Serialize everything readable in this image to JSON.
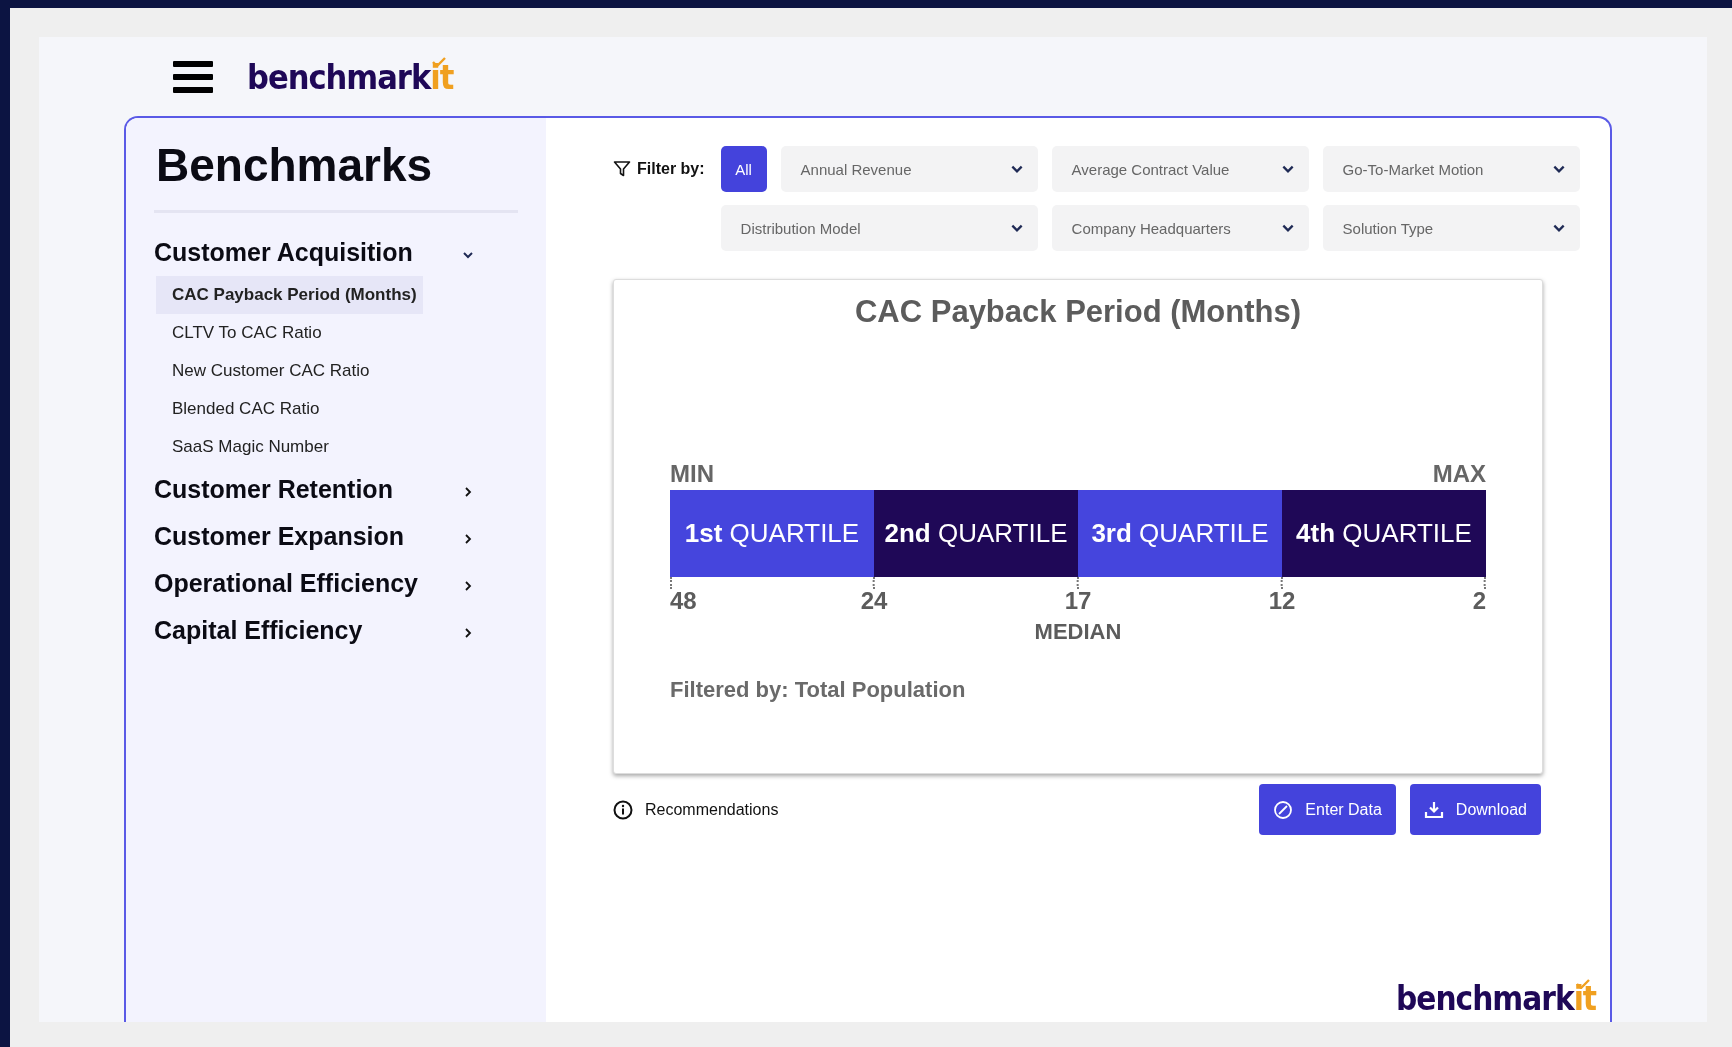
{
  "header": {
    "logo": {
      "text": "benchmark",
      "accent": "it"
    }
  },
  "sidebar": {
    "title": "Benchmarks",
    "sections": [
      {
        "label": "Customer Acquisition",
        "expanded": true,
        "children": [
          {
            "label": "CAC Payback Period (Months)",
            "selected": true
          },
          {
            "label": "CLTV To CAC Ratio",
            "selected": false
          },
          {
            "label": "New Customer CAC Ratio",
            "selected": false
          },
          {
            "label": "Blended CAC Ratio",
            "selected": false
          },
          {
            "label": "SaaS Magic Number",
            "selected": false
          }
        ]
      },
      {
        "label": "Customer Retention",
        "expanded": false
      },
      {
        "label": "Customer Expansion",
        "expanded": false
      },
      {
        "label": "Operational Efficiency",
        "expanded": false
      },
      {
        "label": "Capital Efficiency",
        "expanded": false
      }
    ]
  },
  "filters": {
    "label": "Filter by:",
    "all_button": {
      "label": "All",
      "selected": true
    },
    "dropdowns": [
      {
        "label": "Annual Revenue"
      },
      {
        "label": "Average Contract Value"
      },
      {
        "label": "Go-To-Market Motion"
      },
      {
        "label": "Distribution Model"
      },
      {
        "label": "Company Headquarters"
      },
      {
        "label": "Solution Type"
      }
    ]
  },
  "chart": {
    "title": "CAC Payback Period (Months)",
    "min_label": "MIN",
    "max_label": "MAX",
    "quartiles": [
      {
        "ordinal": "1st",
        "label": "QUARTILE",
        "color": "#4545dd"
      },
      {
        "ordinal": "2nd",
        "label": "QUARTILE",
        "color": "#1f0857"
      },
      {
        "ordinal": "3rd",
        "label": "QUARTILE",
        "color": "#4545dd"
      },
      {
        "ordinal": "4th",
        "label": "QUARTILE",
        "color": "#1f0857"
      }
    ],
    "ticks": [
      "48",
      "24",
      "17",
      "12",
      "2"
    ],
    "median_label": "MEDIAN",
    "filtered_by": "Filtered by: Total Population"
  },
  "actions": {
    "recommendations": "Recommendations",
    "buttons": [
      {
        "kind": "edit",
        "label": "Enter Data"
      },
      {
        "kind": "download",
        "label": "Download"
      }
    ]
  },
  "footer": {
    "logo": {
      "text": "benchmark",
      "accent": "it"
    }
  }
}
